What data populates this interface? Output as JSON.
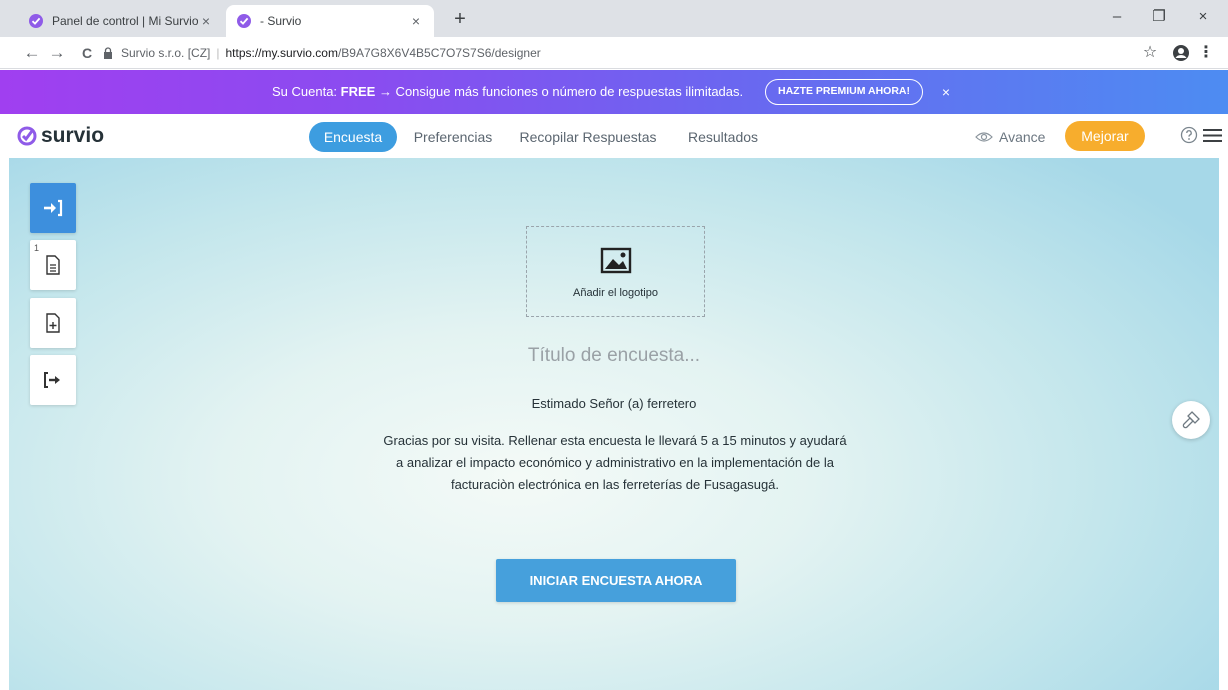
{
  "browser": {
    "tabs": [
      {
        "title": "Panel de control | Mi Survio",
        "active": false
      },
      {
        "title": "- Survio",
        "active": true
      }
    ],
    "new_tab_label": "+",
    "close_glyph": "×",
    "window_controls": {
      "minimize": "–",
      "restore": "❐",
      "close": "×"
    },
    "nav": {
      "back": "←",
      "forward": "→",
      "reload": "C"
    },
    "address": {
      "site_name": "Survio s.r.o. [CZ]",
      "separator": "|",
      "url_host": "https://my.survio.com",
      "url_path": "/B9A7G8X6V4B5C7O7S7S6/designer"
    },
    "toolbar_icons": [
      "star-icon",
      "account-icon",
      "kebab-menu-icon"
    ]
  },
  "banner": {
    "prefix": "Su Cuenta: ",
    "plan": "FREE",
    "message": " → Consigue más funciones o número de respuestas ilimitadas.",
    "cta": "HAZTE PREMIUM AHORA!",
    "close": "×",
    "colors": {
      "start": "#a03ff0",
      "end": "#4d8cf2"
    }
  },
  "header": {
    "logo_text": "survio",
    "tabs": [
      {
        "label": "Encuesta",
        "active": true
      },
      {
        "label": "Preferencias",
        "active": false
      },
      {
        "label": "Recopilar Respuestas",
        "active": false
      },
      {
        "label": "Resultados",
        "active": false
      }
    ],
    "preview_label": "Avance",
    "upgrade_label": "Mejorar",
    "colors": {
      "accent": "#3d9de0",
      "upgrade": "#f7ad2d"
    }
  },
  "sidebar": {
    "items": [
      {
        "icon": "enter-icon",
        "active": true
      },
      {
        "icon": "page-icon",
        "number": "1",
        "active": false
      },
      {
        "icon": "add-page-icon",
        "active": false
      },
      {
        "icon": "exit-icon",
        "active": false
      }
    ]
  },
  "survey": {
    "logo_placeholder": "Añadir el logotipo",
    "title_placeholder": "Título de encuesta...",
    "subtitle": "Estimado Señor (a) ferretero",
    "description_lines": [
      "Gracias por su visita. Rellenar esta encuesta le llevará 5 a 15 minutos y ayudará",
      "a analizar el impacto económico y administrativo en la implementación de la",
      "facturaciòn electrónica en las ferreterías de Fusagasugá."
    ],
    "start_button": "INICIAR ENCUESTA AHORA"
  }
}
